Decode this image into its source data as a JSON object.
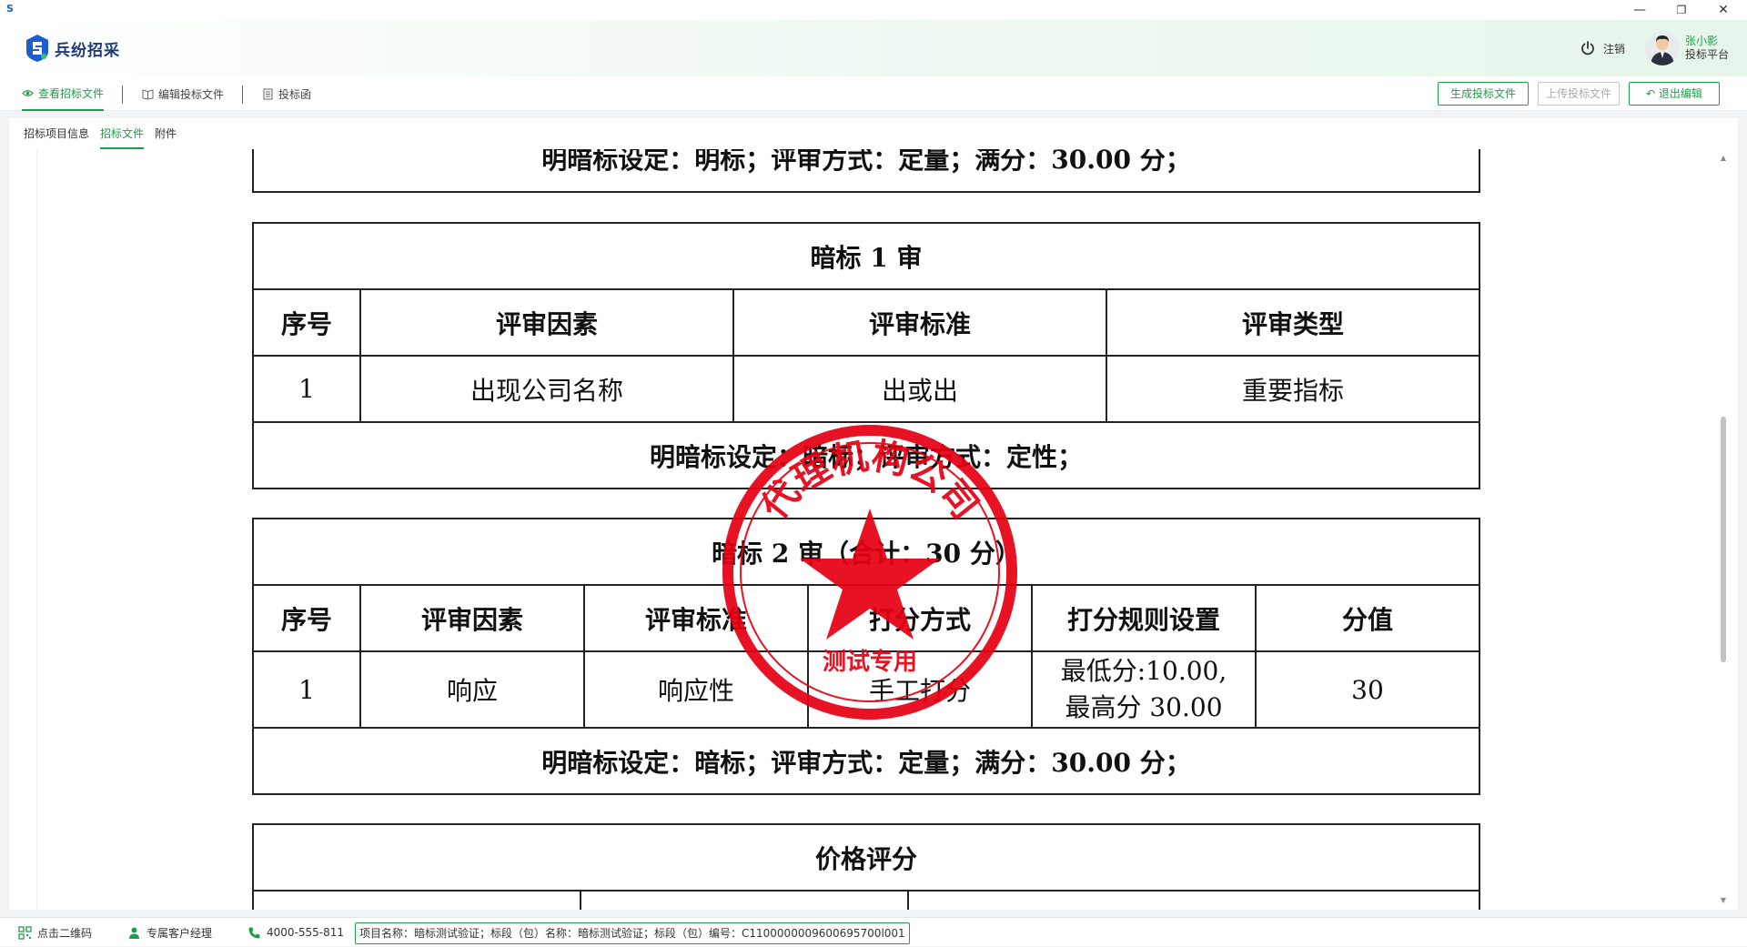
{
  "window": {
    "app_icon_letter": "S",
    "minimize": "—",
    "restore": "❐",
    "close": "✕"
  },
  "header": {
    "logo_text": "兵纷招采",
    "logout_label": "注销",
    "user_name": "张小影",
    "user_role": "投标平台"
  },
  "toolbar": {
    "tabs": [
      {
        "label": "查看招标文件",
        "icon": "eye-icon",
        "active": true
      },
      {
        "label": "编辑投标文件",
        "icon": "book-icon",
        "active": false
      },
      {
        "label": "投标函",
        "icon": "document-icon",
        "active": false
      }
    ],
    "buttons": {
      "generate": "生成投标文件",
      "upload": "上传投标文件",
      "exit": "退出编辑"
    }
  },
  "subtabs": [
    {
      "label": "招标项目信息",
      "active": false
    },
    {
      "label": "招标文件",
      "active": true
    },
    {
      "label": "附件",
      "active": false
    }
  ],
  "document": {
    "top_partial": {
      "footer": "明暗标设定：明标；评审方式：定量；满分：30.00 分；"
    },
    "dark_review_1": {
      "title": "暗标 1 审",
      "headers": [
        "序号",
        "评审因素",
        "评审标准",
        "评审类型"
      ],
      "rows": [
        [
          "1",
          "出现公司名称",
          "出或出",
          "重要指标"
        ]
      ],
      "footer": "明暗标设定：暗标；评审方式：定性；"
    },
    "dark_review_2": {
      "title": "暗标 2 审（合计：30 分）",
      "headers": [
        "序号",
        "评审因素",
        "评审标准",
        "打分方式",
        "打分规则设置",
        "分值"
      ],
      "rows": [
        [
          "1",
          "响应",
          "响应性",
          "手工打分",
          "最低分:10.00,",
          "最高分 30.00",
          "30"
        ]
      ],
      "footer": "明暗标设定：暗标；评审方式：定量；满分：30.00 分；"
    },
    "price_review": {
      "title": "价格评分"
    }
  },
  "seal": {
    "top_text": "代理机构公司",
    "bottom_text": "测试专用",
    "color": "#e60012"
  },
  "statusbar": {
    "qr_label": "点击二维码",
    "manager_label": "专属客户经理",
    "phone": "4000-555-811",
    "project_info": "项目名称：暗标测试验证；标段（包）名称：暗标测试验证；标段（包）编号：C1100000009600695700l001"
  },
  "colors": {
    "accent": "#1f9e4a",
    "brand": "#1c3a78"
  }
}
